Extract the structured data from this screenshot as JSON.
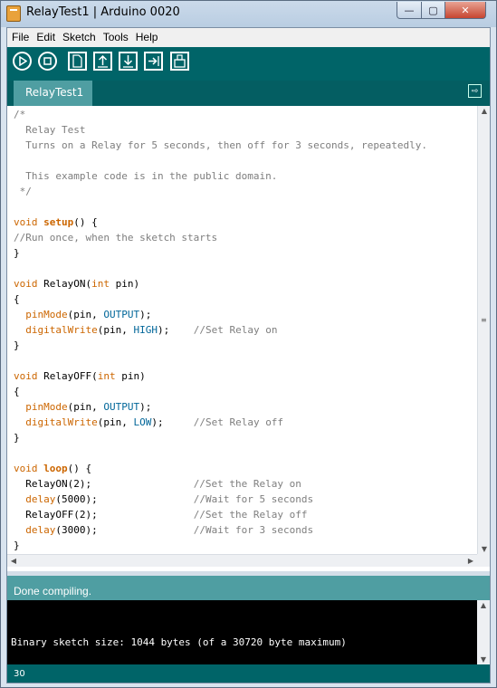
{
  "window": {
    "title": "RelayTest1 | Arduino 0020",
    "minimize_glyph": "—",
    "maximize_glyph": "▢",
    "close_glyph": "✕"
  },
  "menu": [
    "File",
    "Edit",
    "Sketch",
    "Tools",
    "Help"
  ],
  "toolbar": {
    "buttons": [
      "verify-icon",
      "stop-icon",
      "new-icon",
      "open-icon",
      "save-icon",
      "upload-icon",
      "serial-monitor-icon"
    ]
  },
  "tabs": [
    {
      "label": "RelayTest1"
    }
  ],
  "tab_menu_glyph": "⇨",
  "code_lines": [
    [
      [
        "c",
        "/*"
      ]
    ],
    [
      [
        "c",
        "  Relay Test"
      ]
    ],
    [
      [
        "c",
        "  Turns on a Relay for 5 seconds, then off for 3 seconds, repeatedly."
      ]
    ],
    [
      [
        "c",
        ""
      ]
    ],
    [
      [
        "c",
        "  This example code is in the public domain."
      ]
    ],
    [
      [
        "c",
        " */"
      ]
    ],
    [
      [
        "p",
        ""
      ]
    ],
    [
      [
        "k",
        "void"
      ],
      [
        "p",
        " "
      ],
      [
        "b",
        "setup"
      ],
      [
        "p",
        "() {"
      ]
    ],
    [
      [
        "c",
        "//Run once, when the sketch starts"
      ]
    ],
    [
      [
        "p",
        "}"
      ]
    ],
    [
      [
        "p",
        ""
      ]
    ],
    [
      [
        "k",
        "void"
      ],
      [
        "p",
        " RelayON("
      ],
      [
        "k",
        "int"
      ],
      [
        "p",
        " pin)"
      ]
    ],
    [
      [
        "p",
        "{"
      ]
    ],
    [
      [
        "p",
        "  "
      ],
      [
        "k",
        "pinMode"
      ],
      [
        "p",
        "(pin, "
      ],
      [
        "s",
        "OUTPUT"
      ],
      [
        "p",
        ");"
      ]
    ],
    [
      [
        "p",
        "  "
      ],
      [
        "k",
        "digitalWrite"
      ],
      [
        "p",
        "(pin, "
      ],
      [
        "s",
        "HIGH"
      ],
      [
        "p",
        ");    "
      ],
      [
        "c",
        "//Set Relay on"
      ]
    ],
    [
      [
        "p",
        "}"
      ]
    ],
    [
      [
        "p",
        ""
      ]
    ],
    [
      [
        "k",
        "void"
      ],
      [
        "p",
        " RelayOFF("
      ],
      [
        "k",
        "int"
      ],
      [
        "p",
        " pin)"
      ]
    ],
    [
      [
        "p",
        "{"
      ]
    ],
    [
      [
        "p",
        "  "
      ],
      [
        "k",
        "pinMode"
      ],
      [
        "p",
        "(pin, "
      ],
      [
        "s",
        "OUTPUT"
      ],
      [
        "p",
        ");"
      ]
    ],
    [
      [
        "p",
        "  "
      ],
      [
        "k",
        "digitalWrite"
      ],
      [
        "p",
        "(pin, "
      ],
      [
        "s",
        "LOW"
      ],
      [
        "p",
        ");     "
      ],
      [
        "c",
        "//Set Relay off"
      ]
    ],
    [
      [
        "p",
        "}"
      ]
    ],
    [
      [
        "p",
        ""
      ]
    ],
    [
      [
        "k",
        "void"
      ],
      [
        "p",
        " "
      ],
      [
        "b",
        "loop"
      ],
      [
        "p",
        "() {"
      ]
    ],
    [
      [
        "p",
        "  RelayON(2);                 "
      ],
      [
        "c",
        "//Set the Relay on"
      ]
    ],
    [
      [
        "p",
        "  "
      ],
      [
        "k",
        "delay"
      ],
      [
        "p",
        "(5000);                "
      ],
      [
        "c",
        "//Wait for 5 seconds"
      ]
    ],
    [
      [
        "p",
        "  RelayOFF(2);                "
      ],
      [
        "c",
        "//Set the Relay off"
      ]
    ],
    [
      [
        "p",
        "  "
      ],
      [
        "k",
        "delay"
      ],
      [
        "p",
        "(3000);                "
      ],
      [
        "c",
        "//Wait for 3 seconds"
      ]
    ],
    [
      [
        "p",
        "}"
      ]
    ]
  ],
  "status": {
    "message": "Done compiling."
  },
  "console": {
    "output": "Binary sketch size: 1044 bytes (of a 30720 byte maximum)"
  },
  "line_number": "30",
  "colors": {
    "toolbar": "#006468",
    "status": "#4f9ea2",
    "keyword": "#cc6600",
    "constant": "#006699",
    "comment": "#7e7e7e"
  },
  "scroll_arrows": {
    "up": "▲",
    "down": "▼",
    "left": "◀",
    "right": "▶",
    "grip": "≡"
  }
}
